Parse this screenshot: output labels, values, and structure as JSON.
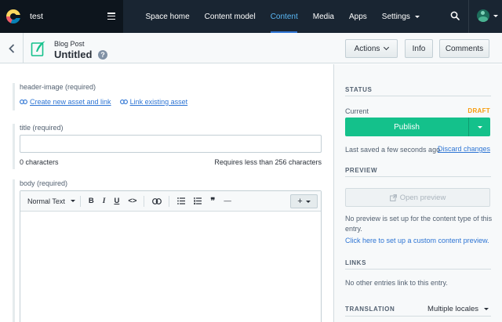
{
  "topnav": {
    "space_name": "test",
    "items": [
      {
        "label": "Space home"
      },
      {
        "label": "Content model"
      },
      {
        "label": "Content"
      },
      {
        "label": "Media"
      },
      {
        "label": "Apps"
      },
      {
        "label": "Settings"
      }
    ],
    "active_item": "Content",
    "colors": {
      "background": "#192532",
      "active": "#5ab8f5"
    }
  },
  "entry_header": {
    "content_type": "Blog Post",
    "title": "Untitled",
    "help_glyph": "?",
    "buttons": {
      "actions": "Actions",
      "info": "Info",
      "comments": "Comments"
    }
  },
  "fields": {
    "header_image": {
      "label": "header-image (required)",
      "create_link": "Create new asset and link",
      "existing_link": "Link existing asset"
    },
    "title": {
      "label": "title (required)",
      "value": "",
      "char_count": "0 characters",
      "limit": "Requires less than 256 characters"
    },
    "body": {
      "label": "body (required)",
      "toolbar": {
        "heading": "Normal Text",
        "bold": "B",
        "italic": "I",
        "underline": "U",
        "code": "<>",
        "bullets": "bulleted-list-icon",
        "numbers": "numbered-list-icon",
        "quote": "❞",
        "hr": "—",
        "embed": "+"
      }
    }
  },
  "sidebar": {
    "status": {
      "heading": "STATUS",
      "current_label": "Current",
      "badge": "DRAFT",
      "publish_label": "Publish",
      "last_saved": "Last saved a few seconds ago",
      "discard": "Discard changes",
      "colors": {
        "publish": "#14c18b",
        "draft": "#f79b0c"
      }
    },
    "preview": {
      "heading": "PREVIEW",
      "button": "Open preview",
      "note": "No preview is set up for the content type of this entry.",
      "setup_link": "Click here to set up a custom content preview."
    },
    "links": {
      "heading": "LINKS",
      "note": "No other entries link to this entry."
    },
    "translation": {
      "heading": "TRANSLATION",
      "selected": "Multiple locales"
    }
  }
}
